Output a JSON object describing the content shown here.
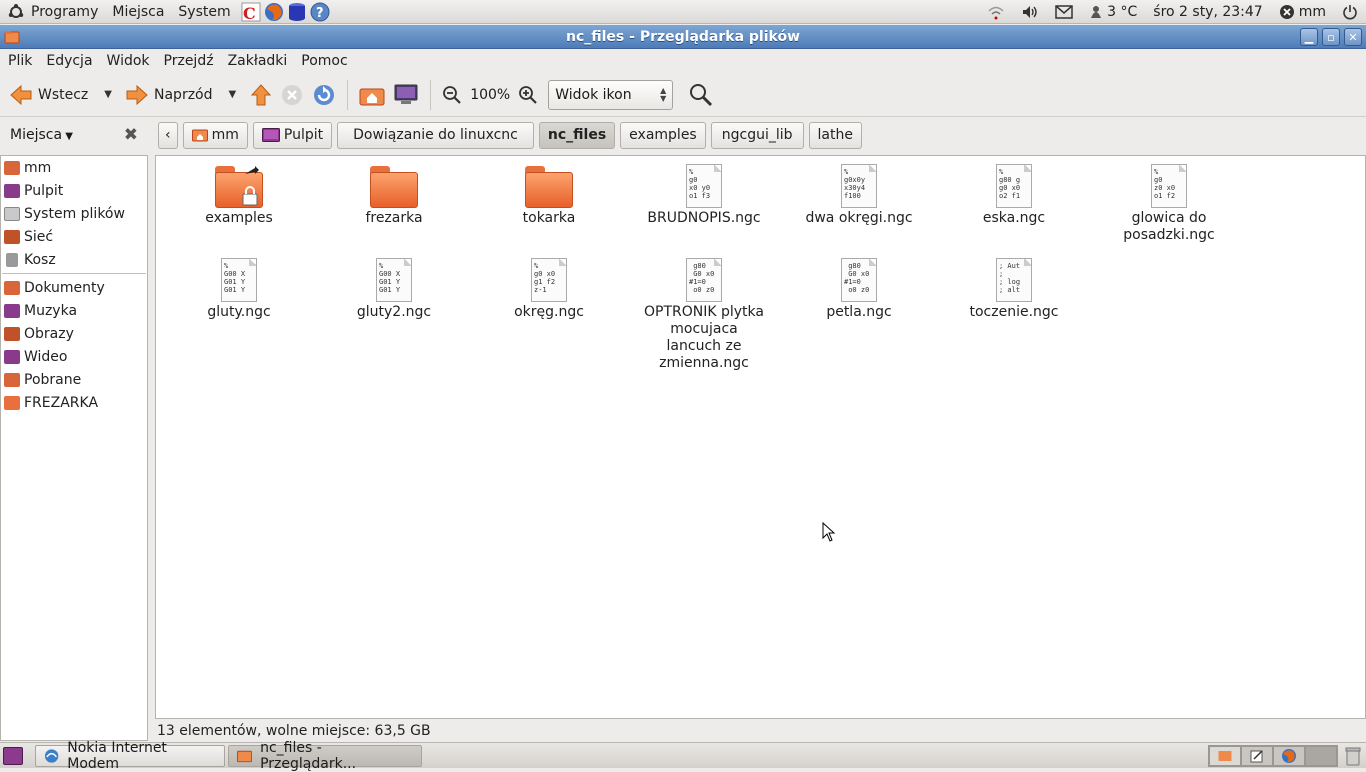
{
  "top_panel": {
    "menus": [
      "Programy",
      "Miejsca",
      "System"
    ],
    "temperature": "3 °C",
    "datetime": "śro  2 sty, 23:47",
    "user": "mm"
  },
  "window": {
    "title": "nc_files - Przeglądarka plików"
  },
  "menubar": [
    "Plik",
    "Edycja",
    "Widok",
    "Przejdź",
    "Zakładki",
    "Pomoc"
  ],
  "toolbar": {
    "back_label": "Wstecz",
    "forward_label": "Naprzód",
    "zoom": "100%",
    "view_mode": "Widok ikon"
  },
  "sidebar": {
    "header": "Miejsca",
    "places": [
      {
        "label": "mm",
        "color": "#d9653a"
      },
      {
        "label": "Pulpit",
        "color": "#8a3a8a"
      },
      {
        "label": "System plików",
        "color": "#9a9a9a"
      },
      {
        "label": "Sieć",
        "color": "#c0522a"
      },
      {
        "label": "Kosz",
        "color": "#888888"
      }
    ],
    "bookmarks": [
      {
        "label": "Dokumenty",
        "color": "#d9653a"
      },
      {
        "label": "Muzyka",
        "color": "#8a3a8a"
      },
      {
        "label": "Obrazy",
        "color": "#c0522a"
      },
      {
        "label": "Wideo",
        "color": "#8a3a8a"
      },
      {
        "label": "Pobrane",
        "color": "#d9653a"
      },
      {
        "label": "FREZARKA",
        "color": "#e8703c"
      }
    ]
  },
  "breadcrumbs": [
    "mm",
    "Pulpit",
    "Dowiązanie do linuxcnc",
    "nc_files",
    "examples",
    "ngcgui_lib",
    "lathe"
  ],
  "files": [
    {
      "name": "examples",
      "type": "folder-link",
      "preview": ""
    },
    {
      "name": "frezarka",
      "type": "folder",
      "preview": ""
    },
    {
      "name": "tokarka",
      "type": "folder",
      "preview": ""
    },
    {
      "name": "BRUDNOPIS.ngc",
      "type": "ngc",
      "preview": "%\ng0\nx0 y0\no1 f3"
    },
    {
      "name": "dwa okręgi.ngc",
      "type": "ngc",
      "preview": "%\ng0x0y\nx30y4\nf100"
    },
    {
      "name": "eska.ngc",
      "type": "ngc",
      "preview": "%\ng80 g\ng0 x0\no2 f1"
    },
    {
      "name": "glowica do posadzki.ngc",
      "type": "ngc",
      "preview": "%\ng0\nz0 x0\no1 f2"
    },
    {
      "name": "gluty.ngc",
      "type": "ngc",
      "preview": "%\nG00 X\nG01 Y\nG01 Y"
    },
    {
      "name": "gluty2.ngc",
      "type": "ngc",
      "preview": "%\nG00 X\nG01 Y\nG01 Y"
    },
    {
      "name": "okręg.ngc",
      "type": "ngc",
      "preview": "%\ng0 x0\ng1 f2\nz-1"
    },
    {
      "name": "OPTRONIK plytka mocujaca lancuch ze zmienna.ngc",
      "type": "ngc",
      "preview": " g80\n G0 x0\n#1=0\n o0 z0"
    },
    {
      "name": "petla.ngc",
      "type": "ngc",
      "preview": " g80\n G0 x0\n#1=0\n o0 z0"
    },
    {
      "name": "toczenie.ngc",
      "type": "ngc",
      "preview": "; Aut\n;\n; log\n; alt"
    }
  ],
  "status": "13 elementów, wolne miejsce: 63,5 GB",
  "taskbar": [
    "Nokia Internet Modem",
    "nc_files - Przeglądark..."
  ]
}
